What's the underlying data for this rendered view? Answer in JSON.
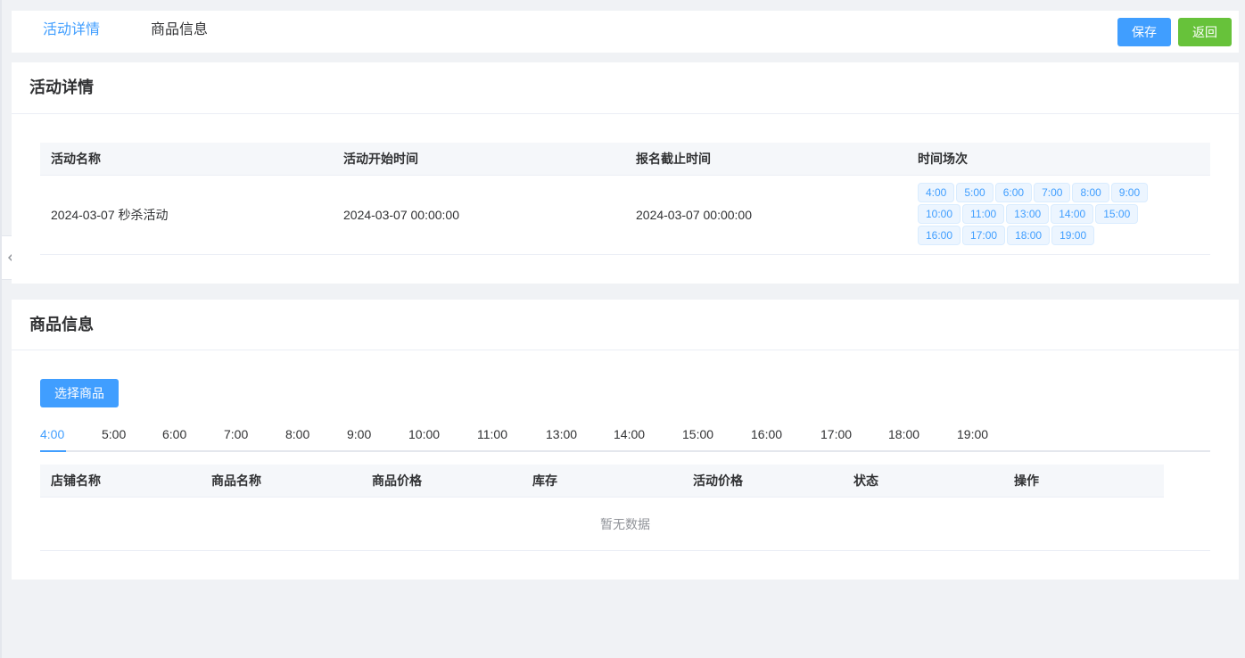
{
  "top_tabs": [
    "活动详情",
    "商品信息"
  ],
  "toolbar": {
    "save_label": "保存",
    "back_label": "返回"
  },
  "activity_section": {
    "title": "活动详情",
    "headers": [
      "活动名称",
      "活动开始时间",
      "报名截止时间",
      "时间场次"
    ],
    "row": {
      "name": "2024-03-07 秒杀活动",
      "start_time": "2024-03-07 00:00:00",
      "deadline": "2024-03-07 00:00:00",
      "time_slots": [
        "4:00",
        "5:00",
        "6:00",
        "7:00",
        "8:00",
        "9:00",
        "10:00",
        "11:00",
        "13:00",
        "14:00",
        "15:00",
        "16:00",
        "17:00",
        "18:00",
        "19:00"
      ]
    }
  },
  "goods_section": {
    "title": "商品信息",
    "select_button": "选择商品",
    "tabs": [
      "4:00",
      "5:00",
      "6:00",
      "7:00",
      "8:00",
      "9:00",
      "10:00",
      "11:00",
      "13:00",
      "14:00",
      "15:00",
      "16:00",
      "17:00",
      "18:00",
      "19:00"
    ],
    "active_tab": "4:00",
    "table_headers": [
      "店铺名称",
      "商品名称",
      "商品价格",
      "库存",
      "活动价格",
      "状态",
      "操作"
    ],
    "empty_text": "暂无数据"
  },
  "colors": {
    "primary": "#409eff",
    "success": "#67c23a",
    "tag_bg": "#ecf5ff"
  },
  "icons": {
    "collapse": "chevron-left-icon"
  }
}
